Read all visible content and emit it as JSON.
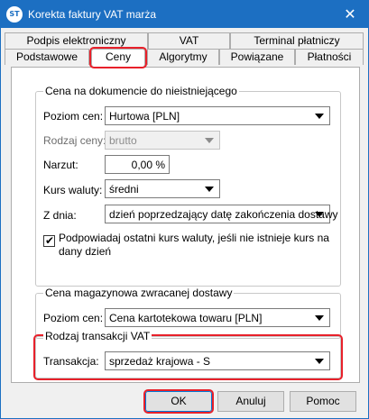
{
  "window": {
    "title": "Korekta faktury VAT marża",
    "app_icon_text": "ST",
    "close_glyph": "✕"
  },
  "tabs": {
    "row1": [
      "Podpis elektroniczny",
      "VAT",
      "Terminal płatniczy"
    ],
    "row2": [
      "Podstawowe",
      "Ceny",
      "Algorytmy",
      "Powiązane",
      "Płatności"
    ],
    "active": "Ceny"
  },
  "group_price_doc": {
    "title": "Cena na dokumencie do nieistniejącego",
    "price_level_label": "Poziom cen:",
    "price_level_value": "Hurtowa [PLN]",
    "price_type_label": "Rodzaj ceny:",
    "price_type_value": "brutto",
    "markup_label": "Narzut:",
    "markup_value": "0,00 %",
    "exchange_rate_label": "Kurs waluty:",
    "exchange_rate_value": "średni",
    "from_day_label": "Z dnia:",
    "from_day_value": "dzień poprzedzający datę zakończenia dostawy",
    "suggest_checkbox_checked": true,
    "suggest_checkbox_label_line1": "Podpowiadaj ostatni kurs waluty, jeśli nie istnieje kurs na",
    "suggest_checkbox_label_line2": "dany dzień"
  },
  "group_warehouse": {
    "title": "Cena magazynowa zwracanej dostawy",
    "price_level_label": "Poziom cen:",
    "price_level_value": "Cena kartotekowa towaru [PLN]"
  },
  "group_vat": {
    "title": "Rodzaj transakcji VAT",
    "transaction_label": "Transakcja:",
    "transaction_value": "sprzedaż krajowa - S"
  },
  "buttons": {
    "ok": "OK",
    "cancel": "Anuluj",
    "help": "Pomoc"
  },
  "colors": {
    "titlebar": "#1c6fc2",
    "highlight": "#e8202a"
  }
}
